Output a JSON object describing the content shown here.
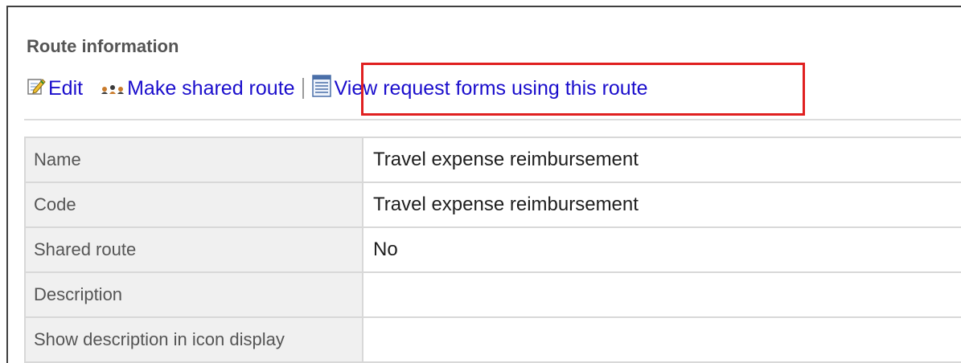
{
  "section": {
    "title": "Route information"
  },
  "actions": {
    "edit_label": "Edit",
    "share_label": "Make shared route",
    "view_forms_label": "View request forms using this route",
    "edit_icon": "edit-icon",
    "share_icon": "shared-route-icon",
    "view_forms_icon": "form-list-icon"
  },
  "highlight": {
    "color": "#e02020",
    "target": "View request forms using this route"
  },
  "colors": {
    "link": "#1a0dcc",
    "label_bg": "#f0f0f0",
    "label_text": "#555555",
    "value_text": "#1e1e1e"
  },
  "rows": [
    {
      "label": "Name",
      "value": "Travel expense reimbursement"
    },
    {
      "label": "Code",
      "value": "Travel expense reimbursement"
    },
    {
      "label": "Shared route",
      "value": "No"
    },
    {
      "label": "Description",
      "value": ""
    },
    {
      "label": "Show description in icon display",
      "value": ""
    }
  ]
}
